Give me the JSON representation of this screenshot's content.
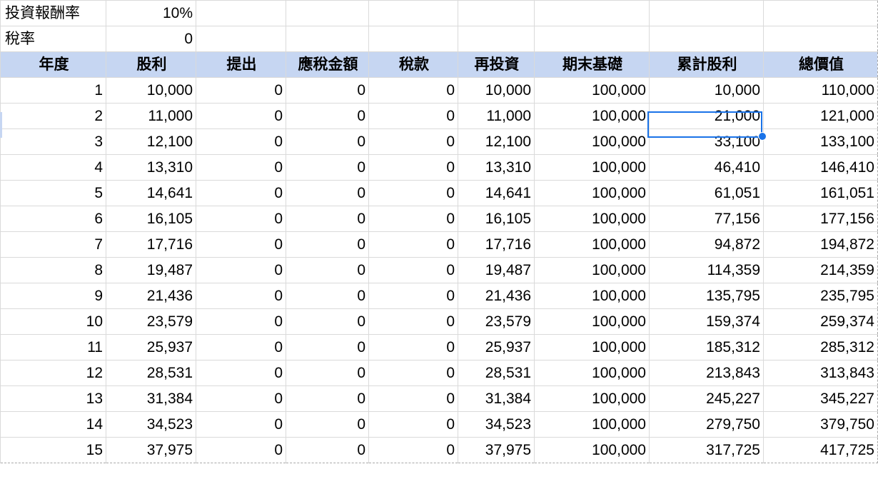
{
  "params": [
    {
      "label": "投資報酬率",
      "value": "10%"
    },
    {
      "label": "稅率",
      "value": "0"
    }
  ],
  "columns": [
    "年度",
    "股利",
    "提出",
    "應稅金額",
    "稅款",
    "再投資",
    "期末基礎",
    "累計股利",
    "總價值"
  ],
  "rows": [
    [
      "1",
      "10,000",
      "0",
      "0",
      "0",
      "10,000",
      "100,000",
      "10,000",
      "110,000"
    ],
    [
      "2",
      "11,000",
      "0",
      "0",
      "0",
      "11,000",
      "100,000",
      "21,000",
      "121,000"
    ],
    [
      "3",
      "12,100",
      "0",
      "0",
      "0",
      "12,100",
      "100,000",
      "33,100",
      "133,100"
    ],
    [
      "4",
      "13,310",
      "0",
      "0",
      "0",
      "13,310",
      "100,000",
      "46,410",
      "146,410"
    ],
    [
      "5",
      "14,641",
      "0",
      "0",
      "0",
      "14,641",
      "100,000",
      "61,051",
      "161,051"
    ],
    [
      "6",
      "16,105",
      "0",
      "0",
      "0",
      "16,105",
      "100,000",
      "77,156",
      "177,156"
    ],
    [
      "7",
      "17,716",
      "0",
      "0",
      "0",
      "17,716",
      "100,000",
      "94,872",
      "194,872"
    ],
    [
      "8",
      "19,487",
      "0",
      "0",
      "0",
      "19,487",
      "100,000",
      "114,359",
      "214,359"
    ],
    [
      "9",
      "21,436",
      "0",
      "0",
      "0",
      "21,436",
      "100,000",
      "135,795",
      "235,795"
    ],
    [
      "10",
      "23,579",
      "0",
      "0",
      "0",
      "23,579",
      "100,000",
      "159,374",
      "259,374"
    ],
    [
      "11",
      "25,937",
      "0",
      "0",
      "0",
      "25,937",
      "100,000",
      "185,312",
      "285,312"
    ],
    [
      "12",
      "28,531",
      "0",
      "0",
      "0",
      "28,531",
      "100,000",
      "213,843",
      "313,843"
    ],
    [
      "13",
      "31,384",
      "0",
      "0",
      "0",
      "31,384",
      "100,000",
      "245,227",
      "345,227"
    ],
    [
      "14",
      "34,523",
      "0",
      "0",
      "0",
      "34,523",
      "100,000",
      "279,750",
      "379,750"
    ],
    [
      "15",
      "37,975",
      "0",
      "0",
      "0",
      "37,975",
      "100,000",
      "317,725",
      "417,725"
    ]
  ],
  "selection": {
    "row": 2,
    "column": "累計股利",
    "value": "21,000"
  },
  "colors": {
    "header_fill": "#c6d6f2",
    "selection_border": "#1a73e8",
    "gridline": "#dadada"
  }
}
